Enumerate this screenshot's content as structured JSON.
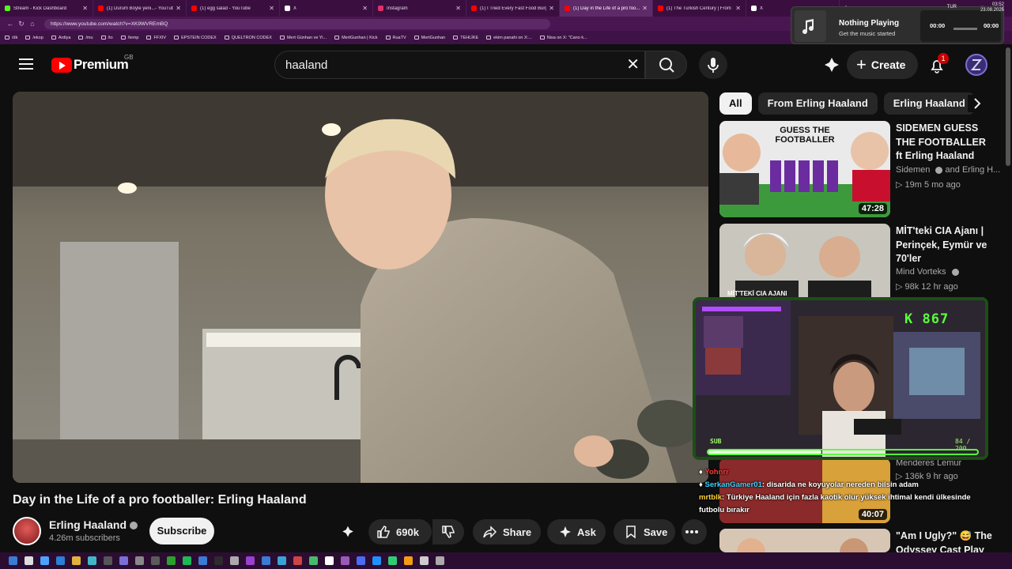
{
  "browser": {
    "tabs": [
      {
        "title": "Stream - Kick Dashboard",
        "color": "#53fc18"
      },
      {
        "title": "(1) Durum Böyle yeni...- YouTube",
        "color": "#ff0000"
      },
      {
        "title": "(1) egg salad - YouTube",
        "color": "#ff0000"
      },
      {
        "title": "X",
        "color": "#ffffff"
      },
      {
        "title": "Instagram",
        "color": "#e1306c"
      },
      {
        "title": "(1) I Tried Every Fast Food Burger i...",
        "color": "#ff0000"
      },
      {
        "title": "(1) Day in the Life of a pro foo...",
        "color": "#ff0000",
        "active": true
      },
      {
        "title": "(1) The Turkish Century | From Hit...",
        "color": "#ff0000"
      },
      {
        "title": "X",
        "color": "#ffffff"
      }
    ],
    "url": "https://www.youtube.com/watch?v=XK9WVREmBQ",
    "bookmarks": [
      "/dk",
      "/ekop",
      "Ardiya",
      "/mu",
      "/to",
      "/temp",
      "FFXIV",
      "EPSTEIN CODEX",
      "QUELTRON CODEX",
      "Mert Günhan ve Yi...",
      "MertGunhan | Kick",
      "RuaTV",
      "MertGunhan",
      "TEHLİKE",
      "ekim panahi on X:...",
      "Nisa on X: \"Cano k..."
    ]
  },
  "now_playing": {
    "title": "Nothing Playing",
    "subtitle": "Get the music started",
    "time_start": "00:00",
    "time_end": "00:00"
  },
  "header": {
    "logo_text": "Premium",
    "country_code": "GB",
    "search_value": "haaland",
    "create_label": "Create",
    "notification_count": "1"
  },
  "video": {
    "title": "Day in the Life of a pro footballer: Erling Haaland",
    "channel": "Erling Haaland",
    "subscribers": "4.26m subscribers",
    "subscribe_label": "Subscribe",
    "likes": "690k",
    "share_label": "Share",
    "ask_label": "Ask",
    "save_label": "Save"
  },
  "chips": [
    "All",
    "From Erling Haaland",
    "Erling Haaland"
  ],
  "recommendations": [
    {
      "title": "SIDEMEN GUESS THE FOOTBALLER ft Erling Haaland",
      "channel": "Sidemen",
      "channel_extra": "and Erling H...",
      "meta": "19m  5 mo ago",
      "duration": "47:28",
      "thumb_text": "GUESS THE FOOTBALLER"
    },
    {
      "title": "MİT'teki CIA Ajanı | Perinçek, Eymür ve 70'ler",
      "channel": "Mind Vorteks",
      "meta": "98k  12 hr ago",
      "thumb_text": "MİT'TEKİ CIA AJANI"
    },
    {
      "title": "",
      "channel": "Menderes Lemur",
      "meta": "136k  9 hr ago",
      "duration": "40:07"
    },
    {
      "title": "\"Am I Ugly?\" 😅 The Odyssey Cast Play A"
    }
  ],
  "stream": {
    "counter": "K 867",
    "sub_label": "SUB",
    "sub_count": "84 / 200",
    "sub_progress": 0.42
  },
  "chat": [
    {
      "user": "Yohnrr",
      "message": ""
    },
    {
      "user": "SerkanGamer01",
      "message": ": disarida ne koyuyolar nereden bilsin adam"
    },
    {
      "user": "mrtblk",
      "message": ": Türkiye Haaland için fazla kaotik olur yüksek ihtimal kendi ülkesinde futbolu bırakır"
    }
  ],
  "taskbar": {
    "language": "TUR",
    "time": "03:52",
    "date": "23.08.2026"
  }
}
